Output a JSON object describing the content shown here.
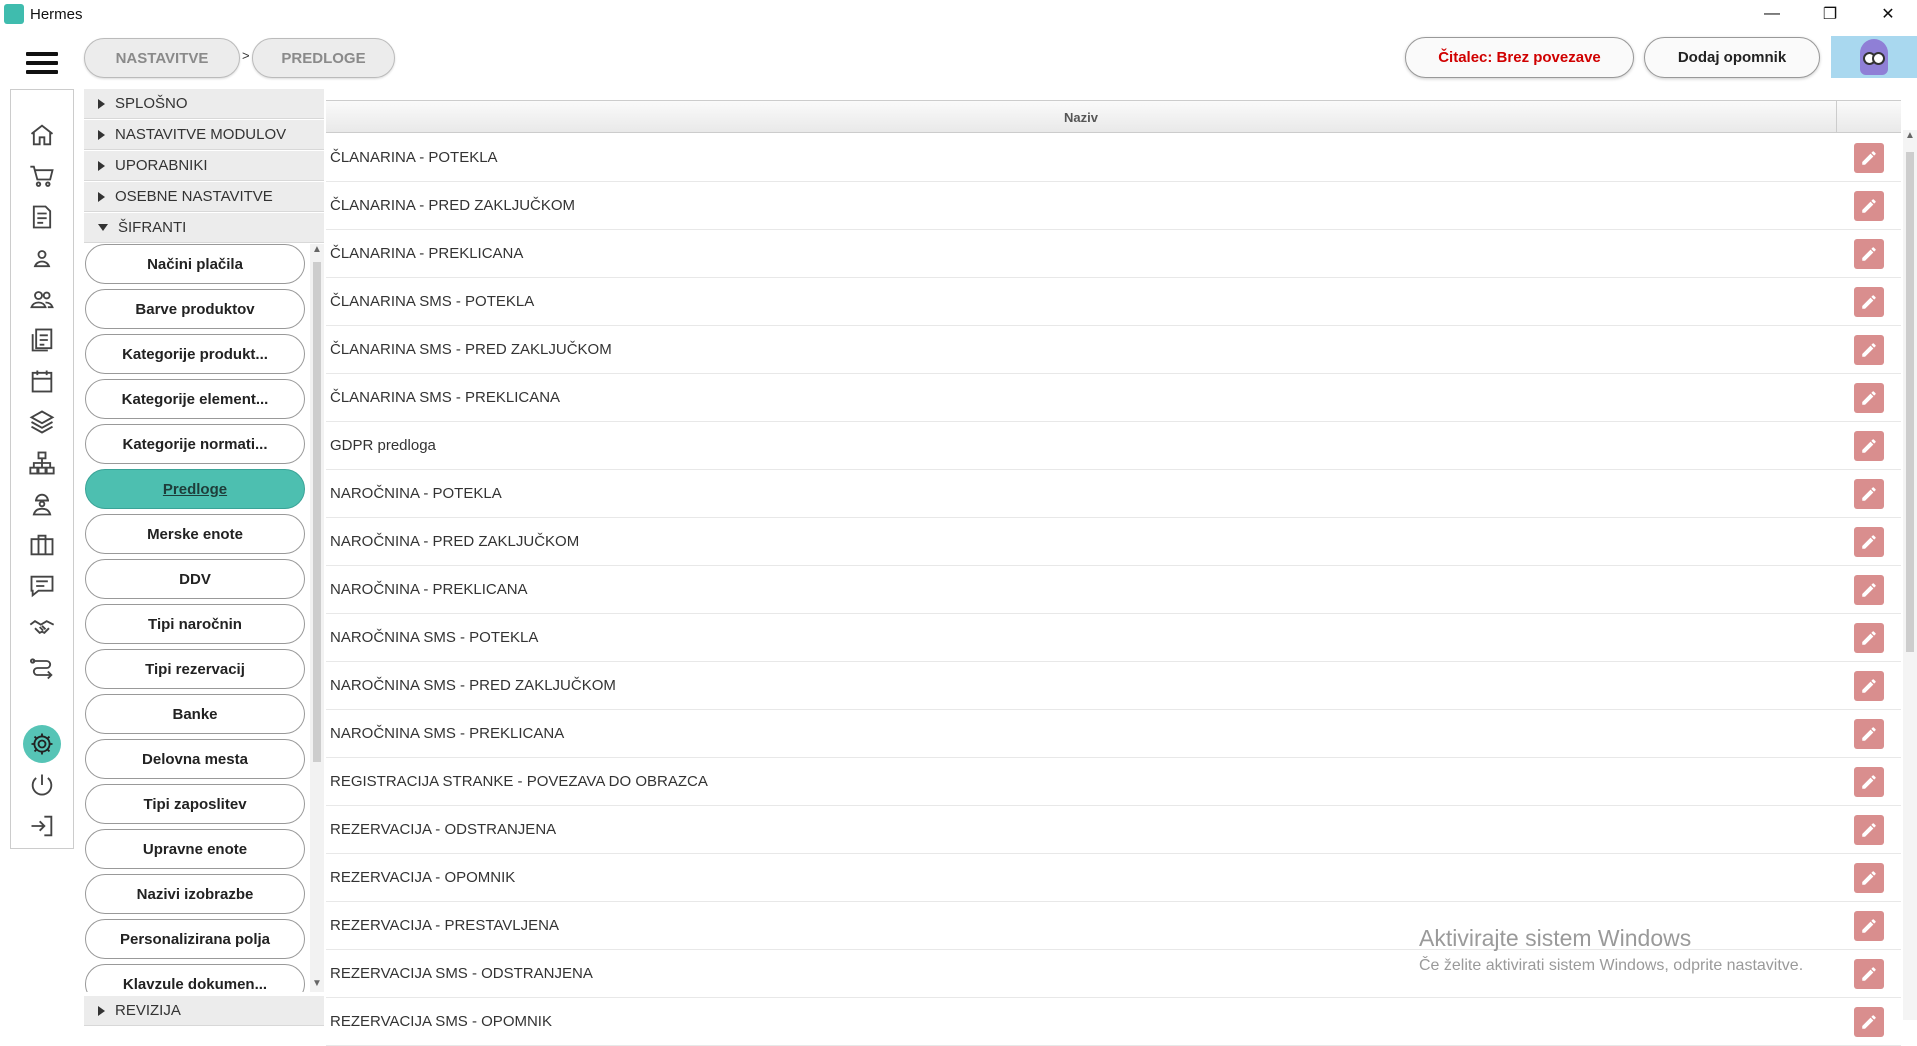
{
  "window": {
    "title": "Hermes",
    "controls": {
      "minimize": "—",
      "restore": "❐",
      "close": "✕"
    }
  },
  "breadcrumb": {
    "items": [
      "NASTAVITVE",
      "PREDLOGE"
    ],
    "separator": ">"
  },
  "header": {
    "reader_status": "Čitalec: Brez povezave",
    "reader_status_color": "#d00000",
    "add_reminder": "Dodaj opomnik"
  },
  "nav": {
    "icons": [
      "home-icon",
      "cart-icon",
      "document-icon",
      "person-icon",
      "people-icon",
      "news-icon",
      "calendar-icon",
      "layers-icon",
      "sitemap-icon",
      "worker-icon",
      "briefcase-icon",
      "chat-icon",
      "handshake-icon",
      "route-icon",
      "gear-icon",
      "power-icon",
      "logout-icon"
    ],
    "active": "gear-icon"
  },
  "categories": [
    {
      "label": "SPLOŠNO",
      "expanded": false
    },
    {
      "label": "NASTAVITVE MODULOV",
      "expanded": false
    },
    {
      "label": "UPORABNIKI",
      "expanded": false
    },
    {
      "label": "OSEBNE NASTAVITVE",
      "expanded": false
    },
    {
      "label": "ŠIFRANTI",
      "expanded": true
    }
  ],
  "sifranti_items": [
    {
      "label": "Načini plačila"
    },
    {
      "label": "Barve produktov"
    },
    {
      "label": "Kategorije produkt..."
    },
    {
      "label": "Kategorije element..."
    },
    {
      "label": "Kategorije normati..."
    },
    {
      "label": "Predloge",
      "active": true
    },
    {
      "label": "Merske enote"
    },
    {
      "label": "DDV"
    },
    {
      "label": "Tipi naročnin"
    },
    {
      "label": "Tipi rezervacij"
    },
    {
      "label": "Banke"
    },
    {
      "label": "Delovna mesta"
    },
    {
      "label": "Tipi zaposlitev"
    },
    {
      "label": "Upravne enote"
    },
    {
      "label": "Nazivi izobrazbe"
    },
    {
      "label": "Personalizirana polja"
    },
    {
      "label": "Klavzule dokumen..."
    }
  ],
  "category_bottom": "REVIZIJA",
  "table": {
    "header": "Naziv",
    "rows": [
      "ČLANARINA - POTEKLA",
      "ČLANARINA - PRED ZAKLJUČKOM",
      "ČLANARINA - PREKLICANA",
      "ČLANARINA SMS - POTEKLA",
      "ČLANARINA SMS - PRED ZAKLJUČKOM",
      "ČLANARINA SMS - PREKLICANA",
      "GDPR predloga",
      "NAROČNINA - POTEKLA",
      "NAROČNINA - PRED ZAKLJUČKOM",
      "NAROČNINA - PREKLICANA",
      "NAROČNINA SMS - POTEKLA",
      "NAROČNINA SMS - PRED ZAKLJUČKOM",
      "NAROČNINA SMS - PREKLICANA",
      "REGISTRACIJA STRANKE - POVEZAVA DO OBRAZCA",
      "REZERVACIJA - ODSTRANJENA",
      "REZERVACIJA - OPOMNIK",
      "REZERVACIJA - PRESTAVLJENA",
      "REZERVACIJA SMS - ODSTRANJENA",
      "REZERVACIJA SMS - OPOMNIK"
    ],
    "edit_color": "#d98e8e"
  },
  "watermark": {
    "title": "Aktivirajte sistem Windows",
    "subtitle": "Če želite aktivirati sistem Windows, odprite nastavitve."
  }
}
